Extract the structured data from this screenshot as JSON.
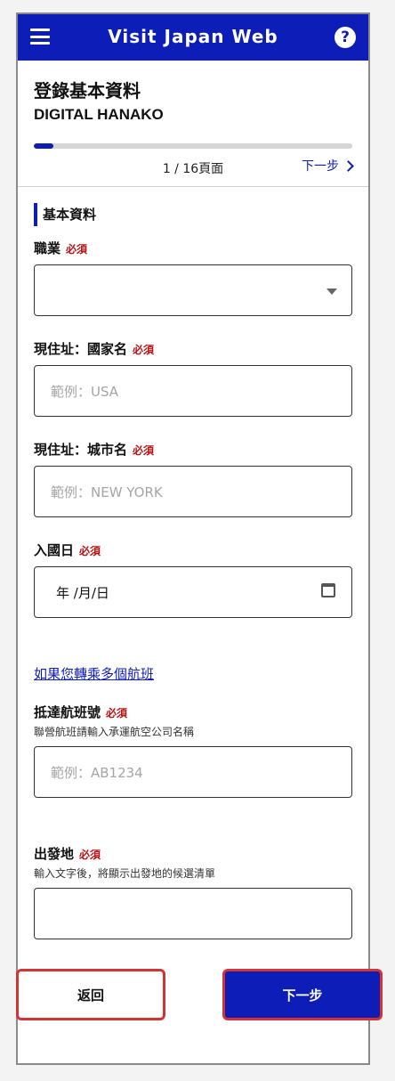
{
  "app": {
    "title": "Visit Japan Web",
    "help_symbol": "?"
  },
  "header": {
    "title": "登錄基本資料",
    "user": "DIGITAL HANAKO",
    "progress": {
      "current": 1,
      "total": 16,
      "label": "1 / 16頁面"
    },
    "next_link": "下一步"
  },
  "section": {
    "title": "基本資料"
  },
  "fields": {
    "occupation": {
      "label": "職業",
      "required": "必須",
      "value": ""
    },
    "country": {
      "label": "現住址：國家名",
      "required": "必須",
      "placeholder": "範例：USA"
    },
    "city": {
      "label": "現住址：城市名",
      "required": "必須",
      "placeholder": "範例：NEW YORK"
    },
    "entry_date": {
      "label": "入國日",
      "required": "必須",
      "value": "年 /月/日"
    },
    "transfer_link": "如果您轉乘多個航班",
    "flight": {
      "label": "抵達航班號",
      "required": "必須",
      "hint": "聯營航班請輸入承運航空公司名稱",
      "placeholder": "範例：AB1234"
    },
    "departure": {
      "label": "出發地",
      "required": "必須",
      "hint": "輸入文字後，將顯示出發地的候選清單",
      "value": ""
    }
  },
  "buttons": {
    "back": "返回",
    "next": "下一步"
  },
  "colors": {
    "brand": "#0d1db8",
    "required": "#b81212",
    "highlight": "#d43333"
  }
}
